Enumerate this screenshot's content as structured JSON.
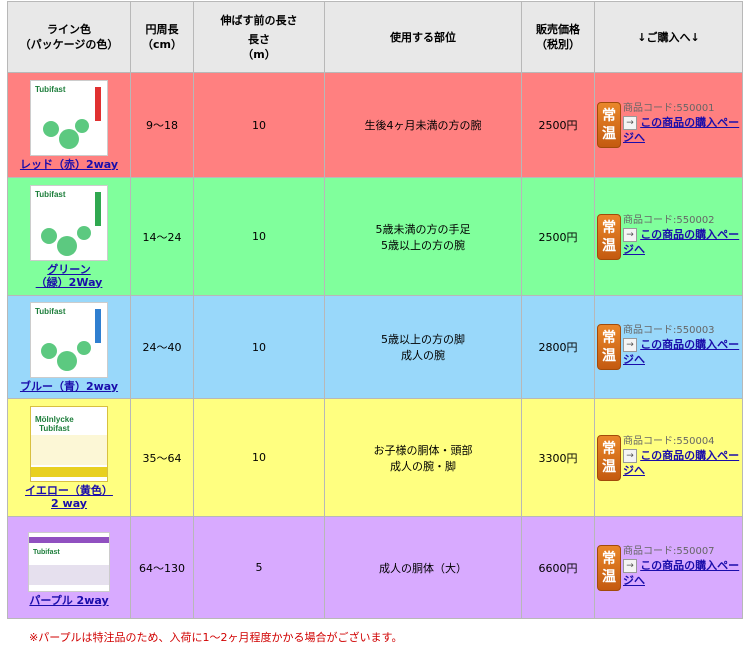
{
  "headers": {
    "line_color": "ライン色\n（パッケージの色）",
    "circumference": "円周長\n（cm）",
    "length_a": "伸ばす前の長さ",
    "length_b": "長さ\n（m）",
    "part": "使用する部位",
    "price": "販売価格\n（税別）",
    "buy": "↓ご購入へ↓"
  },
  "badge": "常温",
  "arrow_icon": "→",
  "buy_link_label": "この商品の購入ページへ",
  "rows": [
    {
      "name": "レッド（赤）2way",
      "circ": "9～18",
      "len": "10",
      "part": "生後4ヶ月未満の方の腕",
      "price": "2500円",
      "code": "商品コード:550001",
      "color": "#ff8080",
      "stripe": "#e03030"
    },
    {
      "name": "グリーン（緑）2Way",
      "circ": "14～24",
      "len": "10",
      "part": "5歳未満の方の手足\n5歳以上の方の腕",
      "price": "2500円",
      "code": "商品コード:550002",
      "color": "#80ff9c",
      "stripe": "#30a850"
    },
    {
      "name": "ブルー（青）2way",
      "circ": "24～40",
      "len": "10",
      "part": "5歳以上の方の脚\n成人の腕",
      "price": "2800円",
      "code": "商品コード:550003",
      "color": "#99d8fa",
      "stripe": "#2f7fd0"
    },
    {
      "name": "イエロー（黄色）2 way",
      "circ": "35～64",
      "len": "10",
      "part": "お子様の胴体・頭部\n成人の腕・脚",
      "price": "3300円",
      "code": "商品コード:550004",
      "color": "#ffff80",
      "stripe": "#e0c020"
    },
    {
      "name": "パープル 2way",
      "circ": "64～130",
      "len": "5",
      "part": "成人の胴体（大）",
      "price": "6600円",
      "code": "商品コード:550007",
      "color": "#d8aaff",
      "stripe": "#9050c0"
    }
  ],
  "note": "※パープルは特注品のため、入荷に1～2ヶ月程度かかる場合がございます。",
  "logo_text": "Tubifast",
  "logo_text_yellow": "Mölnlycke\nTubifast"
}
